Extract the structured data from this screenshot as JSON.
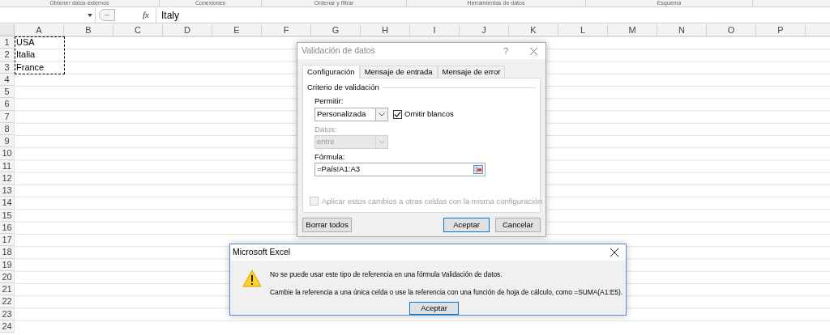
{
  "ribbon_groups": [
    "Obtener datos externos",
    "Conexiones",
    "Ordenar y filtrar",
    "Herramientas de datos",
    "Esquema"
  ],
  "formula_bar": {
    "function_button": "fx",
    "value": "Italy"
  },
  "sheet": {
    "columns": [
      "A",
      "B",
      "C",
      "D",
      "E",
      "F",
      "G",
      "H",
      "I",
      "J",
      "K",
      "L",
      "M",
      "N",
      "O",
      "P"
    ],
    "rows": [
      "1",
      "2",
      "3",
      "4",
      "5",
      "6",
      "7",
      "8",
      "9",
      "10",
      "11",
      "12",
      "13",
      "14",
      "15",
      "16",
      "17",
      "18",
      "19",
      "20",
      "21",
      "22",
      "23",
      "24"
    ],
    "column_a": [
      "USA",
      "Italia",
      "France"
    ],
    "copied": true
  },
  "validation_dialog": {
    "title": "Validación de datos",
    "active": false,
    "help": "?",
    "tabs": [
      {
        "label": "Configuración",
        "selected": true
      },
      {
        "label": "Mensaje de entrada",
        "selected": false
      },
      {
        "label": "Mensaje de error",
        "selected": false
      }
    ],
    "group_label": "Criterio de validación",
    "allow": {
      "label": "Permitir:",
      "value": "Personalizada",
      "disabled": false
    },
    "ignore_blank": {
      "label": "Omitir blancos",
      "checked": true
    },
    "data": {
      "label": "Datos:",
      "value": "entre",
      "disabled": true
    },
    "formula": {
      "label": "Fórmula:",
      "value": "=País!A1:A3"
    },
    "apply_all": {
      "label": "Aplicar estos cambios a otras celdas con la misma configuración",
      "checked": false,
      "disabled": true
    },
    "buttons": [
      {
        "label": "Borrar todos",
        "default": false
      },
      {
        "label": "Aceptar",
        "default": true
      },
      {
        "label": "Cancelar",
        "default": false
      }
    ]
  },
  "alert": {
    "title": "Microsoft Excel",
    "messages": [
      "No se puede usar este tipo de referencia en una fórmula Validación de datos.",
      "Cambie la referencia a una única celda o use la referencia con una función de hoja de cálculo, como =SUMA(A1:E5)."
    ],
    "button": "Aceptar"
  }
}
